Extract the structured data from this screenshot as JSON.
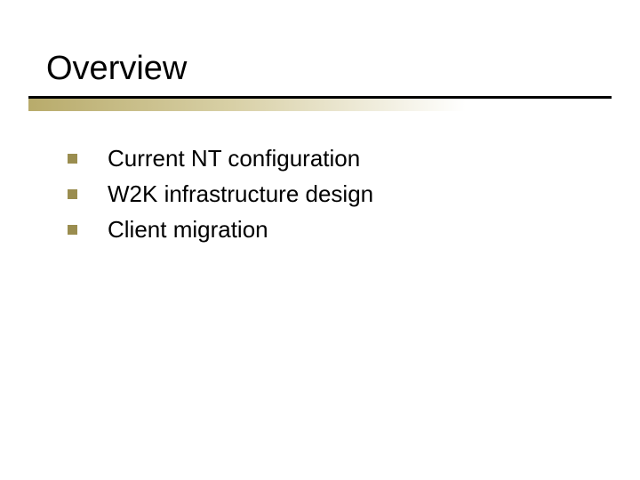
{
  "title": "Overview",
  "bullets": {
    "items": [
      {
        "text": "Current NT configuration"
      },
      {
        "text": "W2K infrastructure design"
      },
      {
        "text": "Client migration"
      }
    ]
  },
  "colors": {
    "bullet": "#9a8d4f",
    "gradient_start": "#b8ab6b"
  }
}
